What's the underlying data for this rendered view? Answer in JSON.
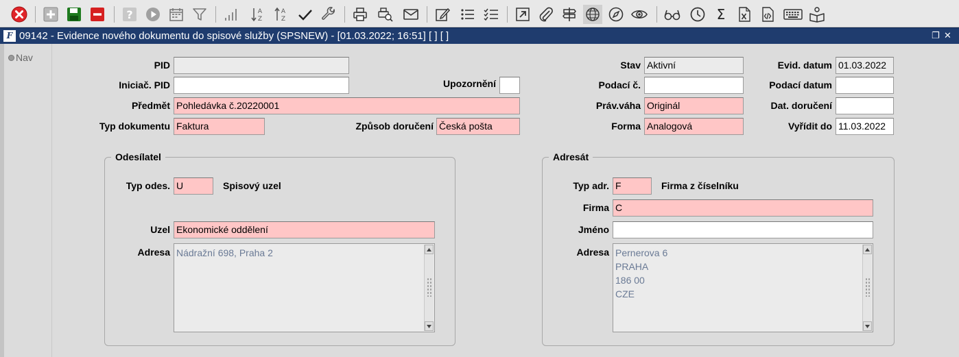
{
  "toolbar": {
    "icons": [
      "close-icon",
      "add-icon",
      "save-icon",
      "delete-icon",
      "help-icon",
      "play-icon",
      "calendar-icon",
      "filter-icon",
      "bar-chart-icon",
      "sort-desc-icon",
      "sort-asc-icon",
      "check-icon",
      "wrench-icon",
      "print-icon",
      "print-preview-icon",
      "mail-icon",
      "edit-icon",
      "list-icon",
      "checklist-icon",
      "open-external-icon",
      "attachment-icon",
      "signpost-icon",
      "globe-icon",
      "compass-icon",
      "eye-icon",
      "glasses-icon",
      "clock-icon",
      "sum-icon",
      "excel-icon",
      "code-file-icon",
      "keyboard-icon",
      "reader-icon"
    ],
    "colors": {
      "close": "#e0252a",
      "save": "#1e7a1e",
      "delete": "#d62020"
    }
  },
  "window": {
    "title": "09142 - Evidence nového dokumentu do spisové služby (SPSNEW) - [01.03.2022; 16:51]  [ ]  [ ]",
    "logo": "F",
    "restore_glyph": "❐",
    "close_glyph": "✕"
  },
  "nav": {
    "label": "Nav"
  },
  "form": {
    "pid": {
      "label": "PID",
      "value": ""
    },
    "iniciac_pid": {
      "label": "Iniciač. PID",
      "value": ""
    },
    "upozorneni": {
      "label": "Upozornění",
      "value": ""
    },
    "predmet": {
      "label": "Předmět",
      "value": "Pohledávka č.20220001"
    },
    "typ_dokumentu": {
      "label": "Typ dokumentu",
      "value": "Faktura"
    },
    "zpusob_doruceni": {
      "label": "Způsob doručení",
      "value": "Česká pošta"
    },
    "stav": {
      "label": "Stav",
      "value": "Aktivní"
    },
    "podaci_c": {
      "label": "Podací č.",
      "value": ""
    },
    "prav_vaha": {
      "label": "Práv.váha",
      "value": "Originál"
    },
    "forma": {
      "label": "Forma",
      "value": "Analogová"
    },
    "evid_datum": {
      "label": "Evid. datum",
      "value": "01.03.2022"
    },
    "podaci_datum": {
      "label": "Podací datum",
      "value": ""
    },
    "dat_doruceni": {
      "label": "Dat. doručení",
      "value": ""
    },
    "vyridit_do": {
      "label": "Vyřídit do",
      "value": "11.03.2022"
    }
  },
  "odesilatel": {
    "title": "Odesílatel",
    "typ_odes": {
      "label": "Typ odes.",
      "value": "U",
      "desc": "Spisový uzel"
    },
    "uzel": {
      "label": "Uzel",
      "value": "Ekonomické oddělení"
    },
    "adresa": {
      "label": "Adresa",
      "lines": [
        "Nádražní 698, Praha 2"
      ]
    }
  },
  "adresat": {
    "title": "Adresát",
    "typ_adr": {
      "label": "Typ adr.",
      "value": "F",
      "desc": "Firma z číselníku"
    },
    "firma": {
      "label": "Firma",
      "value": "C"
    },
    "jmeno": {
      "label": "Jméno",
      "value": ""
    },
    "adresa": {
      "label": "Adresa",
      "lines": [
        "Pernerova 6",
        "PRAHA",
        "186 00",
        "CZE"
      ]
    }
  }
}
